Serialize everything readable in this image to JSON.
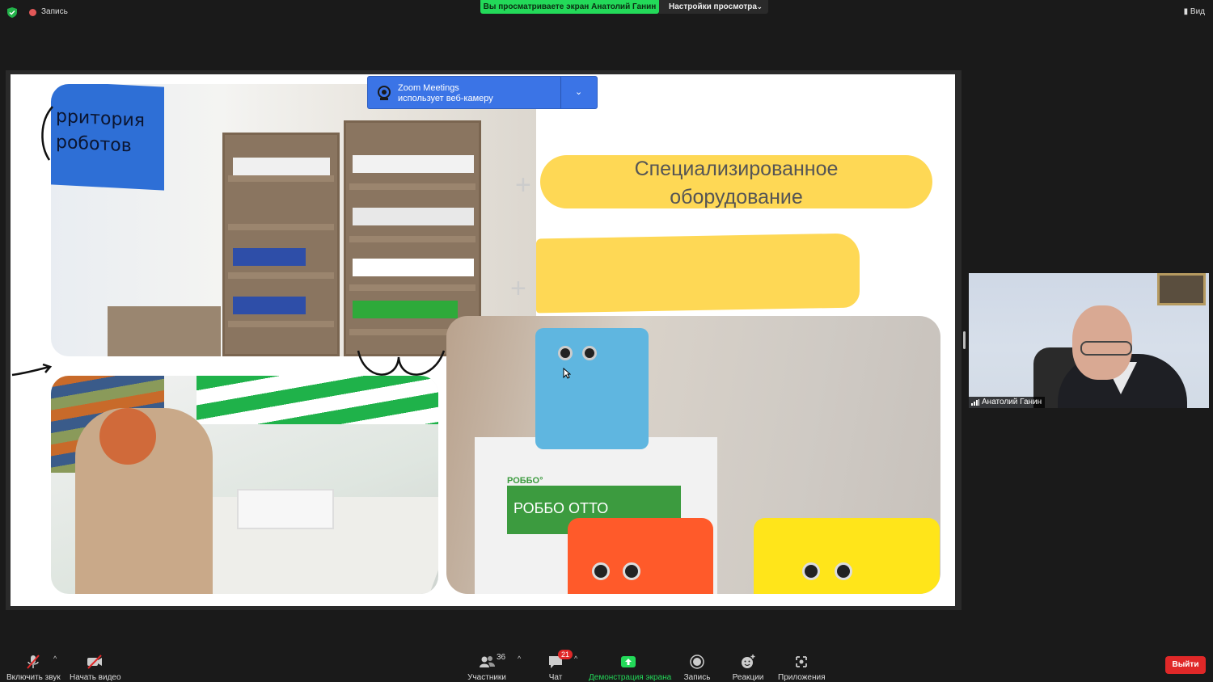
{
  "topbar": {
    "recording_label": "Запись",
    "viewing_banner": "Вы просматриваете экран Анатолий Ганин",
    "view_settings_label": "Настройки просмотра",
    "view_button_label": "Вид"
  },
  "slide": {
    "title": "Специализированное оборудование",
    "tv_text": "рритория\nроботов",
    "box_brand": "РОББО°",
    "box_label": "РОББО ОТТО"
  },
  "toast": {
    "title": "Zoom Meetings",
    "subtitle": "использует веб-камеру"
  },
  "participant": {
    "name": "Анатолий Ганин"
  },
  "toolbar": {
    "unmute_label": "Включить звук",
    "start_video_label": "Начать видео",
    "participants_label": "Участники",
    "participants_count": "36",
    "chat_label": "Чат",
    "chat_badge": "21",
    "share_label": "Демонстрация экрана",
    "record_label": "Запись",
    "reactions_label": "Реакции",
    "apps_label": "Приложения",
    "leave_label": "Выйти"
  },
  "colors": {
    "share_green": "#23d959",
    "slide_yellow": "#fed855",
    "toast_blue": "#3b74e6",
    "leave_red": "#e02828"
  }
}
